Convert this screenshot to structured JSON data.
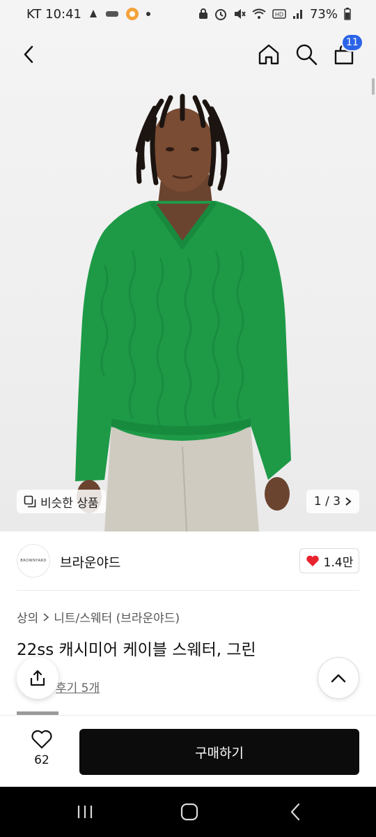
{
  "status_bar": {
    "carrier_time": "KT 10:41",
    "battery": "73%"
  },
  "header": {
    "cart_count": "11"
  },
  "gallery": {
    "similar_label": "비슷한 상품",
    "page_indicator": "1 / 3"
  },
  "seller": {
    "avatar_text": "BROWNYARD",
    "name": "브라운야드",
    "likes": "1.4만"
  },
  "product": {
    "breadcrumb": [
      "상의",
      "니트/스웨터 (브라운야드)"
    ],
    "title": "22ss 캐시미어 케이블 스웨터, 그린",
    "reviews": "후기 5개"
  },
  "bottom_bar": {
    "wish_count": "62",
    "buy_label": "구매하기"
  },
  "colors": {
    "sweater_green": "#1e9a47",
    "cart_badge": "#2c64e8",
    "like_heart": "#e8222e",
    "buy_button_bg": "#0c0c0c"
  },
  "icons": [
    "back-icon",
    "home-icon",
    "search-icon",
    "cart-icon",
    "copy-icon",
    "chevron-right-icon",
    "heart-icon",
    "share-icon",
    "chevron-up-icon"
  ]
}
